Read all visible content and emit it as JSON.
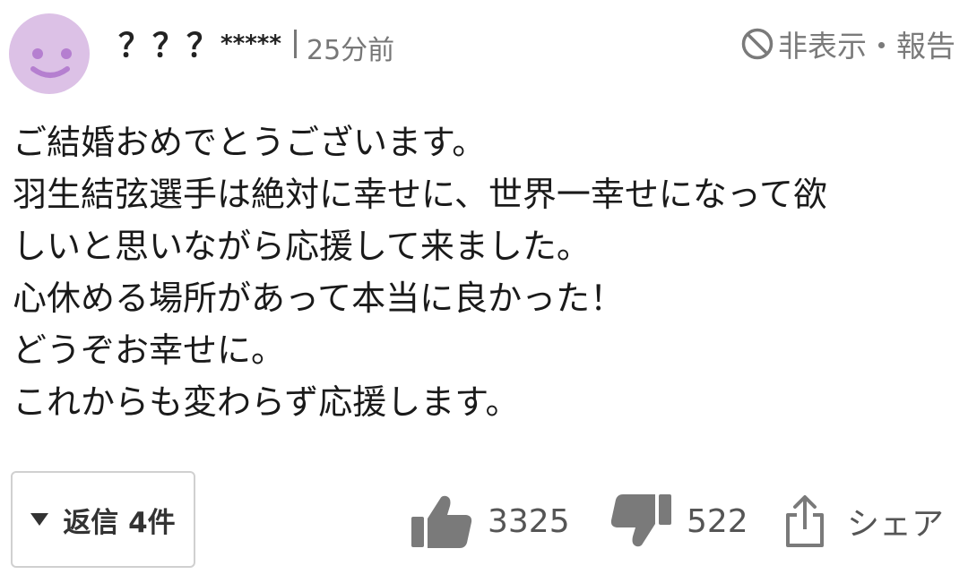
{
  "comment": {
    "user": {
      "name": "？？？",
      "masked_suffix": "*****"
    },
    "timestamp": "25分前",
    "hide_report_label": "非表示・報告",
    "body_lines": [
      "ご結婚おめでとうございます。",
      "羽生結弦選手は絶対に幸せに、世界一幸せになって欲",
      "しいと思いながら応援して来ました。",
      "心休める場所があって本当に良かった！",
      "どうぞお幸せに。",
      "これからも変わらず応援します。"
    ],
    "reply_button_label": "返信 4件",
    "like_count": "3325",
    "dislike_count": "522",
    "share_label": "シェア"
  },
  "colors": {
    "avatar_bg": "#dcc1e6",
    "avatar_face": "#b57fd0",
    "icon_gray": "#7a7a7a",
    "text_main": "#1a1a1a",
    "text_muted": "#777777"
  },
  "icons": {
    "avatar": "smiley-avatar-icon",
    "hide": "ban-icon",
    "reply": "triangle-down-icon",
    "like": "thumbs-up-icon",
    "dislike": "thumbs-down-icon",
    "share": "share-icon"
  }
}
